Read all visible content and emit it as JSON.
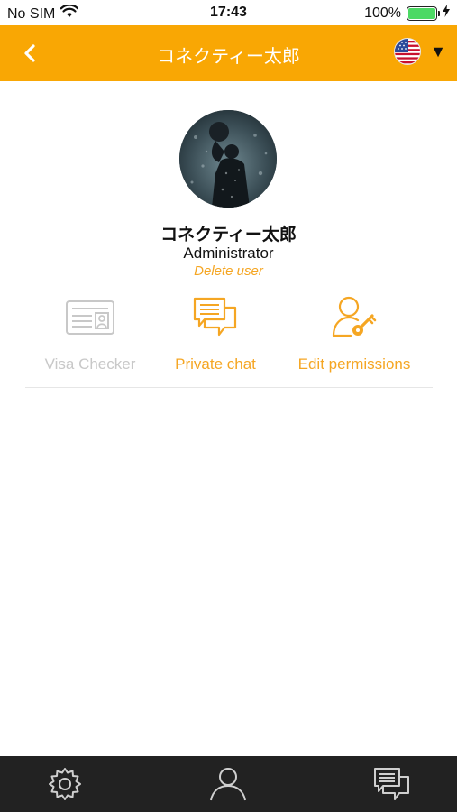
{
  "status_bar": {
    "carrier": "No SIM",
    "time": "17:43",
    "battery": "100%",
    "battery_level": 1.0,
    "battery_color": "#4cd964"
  },
  "nav": {
    "title": "コネクティー太郎",
    "background": "#f9a704",
    "back_icon": "chevron-left-icon",
    "language_flag": "us-flag-icon",
    "language_caret": "▼"
  },
  "profile": {
    "name": "コネクティー太郎",
    "role": "Administrator",
    "delete_label": "Delete user",
    "accent": "#f5a623"
  },
  "actions": [
    {
      "label": "Visa Checker",
      "icon": "id-card-icon",
      "enabled": false
    },
    {
      "label": "Private chat",
      "icon": "chat-bubbles-icon",
      "enabled": true
    },
    {
      "label": "Edit permissions",
      "icon": "user-key-icon",
      "enabled": true
    }
  ],
  "tab_bar": {
    "tabs": [
      {
        "name": "settings",
        "icon": "gear-icon"
      },
      {
        "name": "profile",
        "icon": "user-icon"
      },
      {
        "name": "messages",
        "icon": "chat-bubbles-icon"
      }
    ],
    "background": "#222222"
  }
}
